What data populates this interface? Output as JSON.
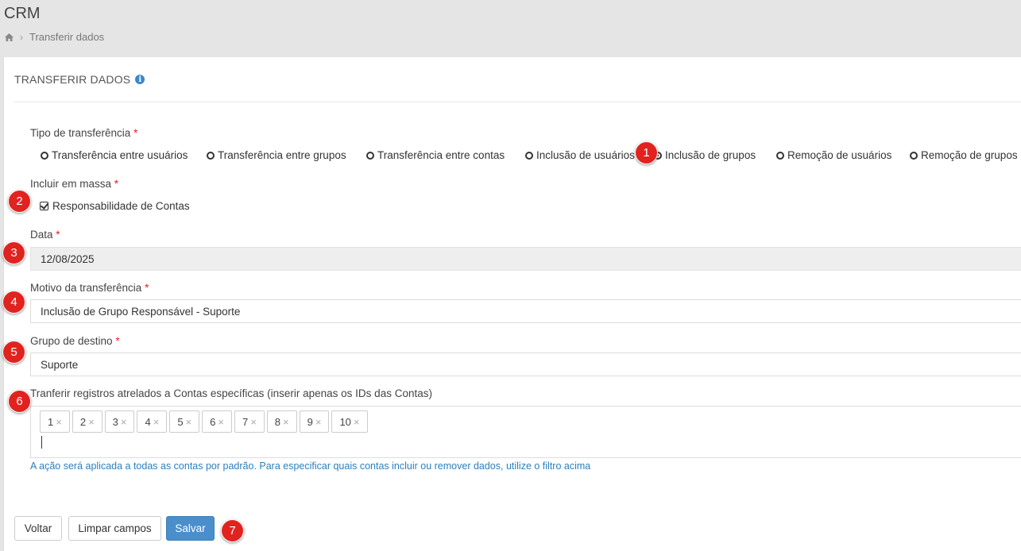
{
  "app": {
    "title": "CRM"
  },
  "breadcrumb": {
    "current": "Transferir dados",
    "separator": "›"
  },
  "card": {
    "title": "TRANSFERIR DADOS",
    "info_glyph": "i"
  },
  "transfer_type": {
    "label": "Tipo de transferência",
    "required_mark": "*",
    "options": [
      {
        "label": "Transferência entre usuários",
        "selected": false
      },
      {
        "label": "Transferência entre grupos",
        "selected": false
      },
      {
        "label": "Transferência entre contas",
        "selected": false
      },
      {
        "label": "Inclusão de usuários",
        "selected": false
      },
      {
        "label": "Inclusão de grupos",
        "selected": true
      },
      {
        "label": "Remoção de usuários",
        "selected": false
      },
      {
        "label": "Remoção de grupos",
        "selected": false
      }
    ]
  },
  "bulk_include": {
    "label": "Incluir em massa",
    "required_mark": "*",
    "checkbox_label": "Responsabilidade de Contas",
    "checked": true
  },
  "date": {
    "label": "Data",
    "required_mark": "*",
    "value": "12/08/2025"
  },
  "reason": {
    "label": "Motivo da transferência",
    "required_mark": "*",
    "value": "Inclusão de Grupo Responsável - Suporte"
  },
  "target_group": {
    "label": "Grupo de destino",
    "required_mark": "*",
    "value": "Suporte"
  },
  "accounts": {
    "label": "Tranferir registros atrelados a Contas específicas (inserir apenas os IDs das Contas)",
    "tags": [
      "1",
      "2",
      "3",
      "4",
      "5",
      "6",
      "7",
      "8",
      "9",
      "10"
    ],
    "tag_remove_glyph": "×",
    "help": "A ação será aplicada a todas as contas por padrão. Para especificar quais contas incluir ou remover dados, utilize o filtro acima"
  },
  "buttons": {
    "back": "Voltar",
    "clear": "Limpar campos",
    "save": "Salvar"
  },
  "badges": [
    "1",
    "2",
    "3",
    "4",
    "5",
    "6",
    "7"
  ],
  "colors": {
    "primary": "#4a8fcb",
    "required": "#e02020",
    "badge": "#e1231f",
    "help_link": "#2e7fb8",
    "info": "#3a87c8"
  }
}
